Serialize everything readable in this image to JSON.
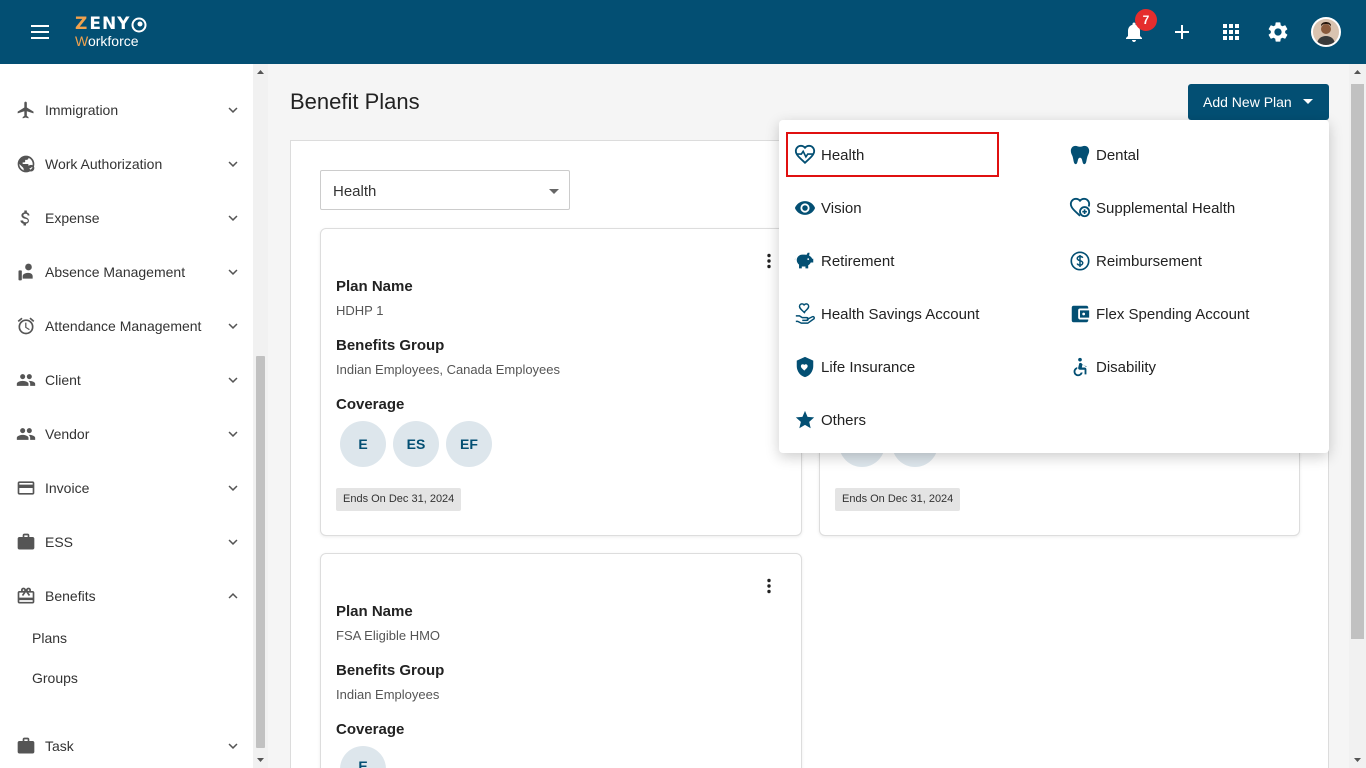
{
  "app": {
    "logo_main": "ZENY",
    "logo_sub": "Workforce",
    "notification_count": "7"
  },
  "sidebar": {
    "items": [
      {
        "label": "Immigration",
        "icon": "airplane-icon"
      },
      {
        "label": "Work Authorization",
        "icon": "globe-icon"
      },
      {
        "label": "Expense",
        "icon": "dollar-icon"
      },
      {
        "label": "Absence Management",
        "icon": "absence-icon"
      },
      {
        "label": "Attendance Management",
        "icon": "alarm-clock-icon"
      },
      {
        "label": "Client",
        "icon": "people-icon"
      },
      {
        "label": "Vendor",
        "icon": "people-icon"
      },
      {
        "label": "Invoice",
        "icon": "credit-card-icon"
      },
      {
        "label": "ESS",
        "icon": "briefcase-icon"
      },
      {
        "label": "Benefits",
        "icon": "gift-card-icon",
        "expanded": true
      },
      {
        "label": "Task",
        "icon": "briefcase-icon"
      }
    ],
    "benefits_sub": [
      "Plans",
      "Groups"
    ]
  },
  "main": {
    "page_title": "Benefit Plans",
    "add_button_label": "Add New Plan",
    "plan_type_select": "Health",
    "labels": {
      "plan_name": "Plan Name",
      "benefits_group": "Benefits Group",
      "coverage": "Coverage"
    },
    "cards": [
      {
        "plan_name": "HDHP 1",
        "benefits_group": "Indian Employees, Canada Employees",
        "coverage": [
          "E",
          "ES",
          "EF"
        ],
        "ends": "Ends On Dec 31, 2024"
      },
      {
        "ends": "Ends On Dec 31, 2024"
      },
      {
        "plan_name": "FSA Eligible HMO",
        "benefits_group": "Indian Employees",
        "coverage": [
          "E"
        ]
      }
    ]
  },
  "dropdown": {
    "highlighted": "Health",
    "items": [
      {
        "label": "Health",
        "icon": "heart-pulse-icon"
      },
      {
        "label": "Dental",
        "icon": "tooth-icon"
      },
      {
        "label": "Vision",
        "icon": "eye-icon"
      },
      {
        "label": "Supplemental Health",
        "icon": "heart-plus-icon"
      },
      {
        "label": "Retirement",
        "icon": "piggy-bank-icon"
      },
      {
        "label": "Reimbursement",
        "icon": "dollar-circle-icon"
      },
      {
        "label": "Health Savings Account",
        "icon": "hand-heart-icon"
      },
      {
        "label": "Flex Spending Account",
        "icon": "wallet-icon"
      },
      {
        "label": "Life Insurance",
        "icon": "shield-heart-icon"
      },
      {
        "label": "Disability",
        "icon": "wheelchair-icon"
      },
      {
        "label": "Others",
        "icon": "star-icon"
      }
    ]
  },
  "colors": {
    "primary": "#034f73",
    "accent": "#f0a24e",
    "badge": "#e52d2d",
    "highlight_border": "#e01010"
  }
}
